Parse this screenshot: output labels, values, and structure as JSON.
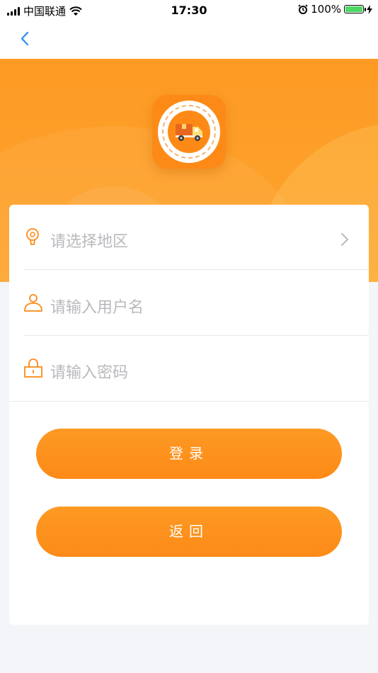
{
  "status_bar": {
    "carrier": "中国联通",
    "time": "17:30",
    "battery": "100%",
    "battery_level": 1.0
  },
  "nav": {
    "back_icon": "chevron-left-icon"
  },
  "header": {
    "logo_icon": "delivery-truck-icon"
  },
  "form": {
    "region": {
      "placeholder": "请选择地区",
      "icon": "location-pin-icon"
    },
    "username": {
      "placeholder": "请输入用户名",
      "icon": "user-icon"
    },
    "password": {
      "placeholder": "请输入密码",
      "icon": "lock-icon"
    }
  },
  "buttons": {
    "login_label": "登录",
    "back_label": "返回"
  },
  "colors": {
    "accent": "#fd8a17",
    "nav_blue": "#2a8cf0",
    "placeholder": "#b9b9be"
  }
}
